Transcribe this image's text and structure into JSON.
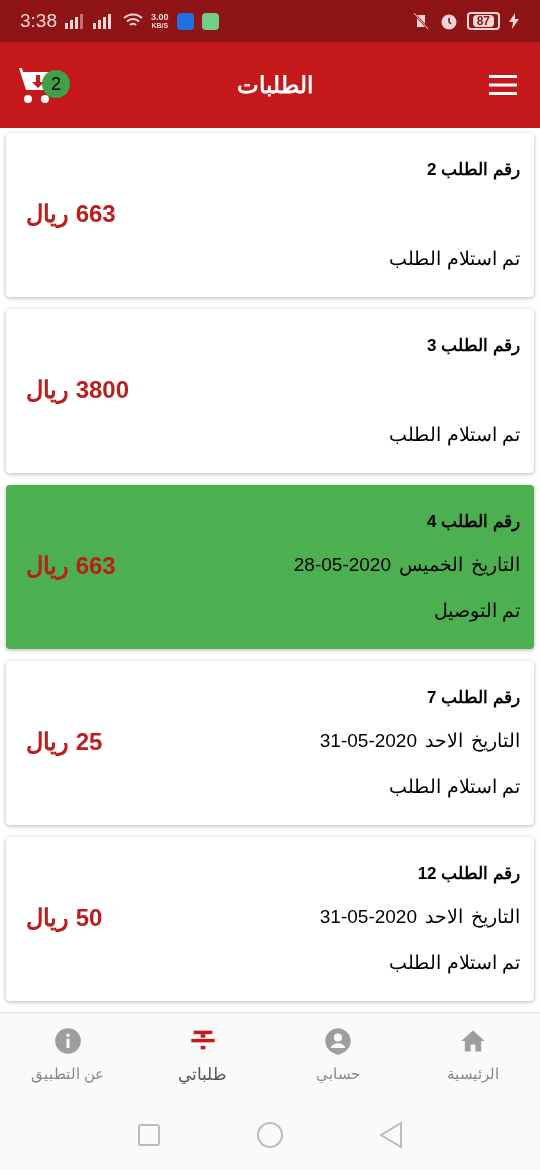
{
  "status_bar": {
    "time": "3:38",
    "speed": "3.00",
    "speed_unit": "KB/S",
    "battery": "87"
  },
  "header": {
    "title": "الطلبات",
    "cart_count": "2"
  },
  "orders": [
    {
      "title": "رقم الطلب 2",
      "price": "663 ريال",
      "status": "تم استلام الطلب",
      "delivered": false
    },
    {
      "title": "رقم الطلب 3",
      "price": "3800 ريال",
      "status": "تم استلام الطلب",
      "delivered": false
    },
    {
      "title": "رقم الطلب 4",
      "date_label": "التاريخ",
      "day": "الخميس",
      "date": "28-05-2020",
      "price": "663 ريال",
      "status": "تم التوصيل",
      "delivered": true
    },
    {
      "title": "رقم الطلب 7",
      "date_label": "التاريخ",
      "day": "الاحد",
      "date": "31-05-2020",
      "price": "25 ريال",
      "status": "تم استلام الطلب",
      "delivered": false
    },
    {
      "title": "رقم الطلب 12",
      "date_label": "التاريخ",
      "day": "الاحد",
      "date": "31-05-2020",
      "price": "50 ريال",
      "status": "تم استلام الطلب",
      "delivered": false
    }
  ],
  "bottom_nav": [
    {
      "kind": "home",
      "label": "الرئيسية",
      "selected": false
    },
    {
      "kind": "account",
      "label": "حسابي",
      "selected": false
    },
    {
      "kind": "orders",
      "label": "طلباتي",
      "selected": true
    },
    {
      "kind": "info",
      "label": "عن التطبيق",
      "selected": false
    }
  ]
}
